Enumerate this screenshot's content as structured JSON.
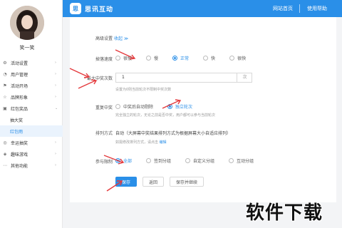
{
  "brand": {
    "logo_glyph": "思",
    "name": "思讯互动"
  },
  "topnav": {
    "home": "网站首页",
    "help": "使用帮助"
  },
  "sidebar": {
    "username": "笑一笑",
    "items": [
      {
        "label": "活动设置",
        "icon": "gear-icon",
        "glyph": "⚙"
      },
      {
        "label": "用户管理",
        "icon": "user-icon",
        "glyph": "👤"
      },
      {
        "label": "活动开场",
        "icon": "flag-icon",
        "glyph": "⚑"
      },
      {
        "label": "品牌形象",
        "icon": "star-icon",
        "glyph": "☆"
      },
      {
        "label": "红包奖品",
        "icon": "gift-icon",
        "glyph": "▣"
      },
      {
        "label": "抽大奖",
        "sub": true
      },
      {
        "label": "红包雨",
        "sub": true,
        "active": true
      },
      {
        "label": "幸运抽奖",
        "icon": "lottery-icon",
        "glyph": "◎"
      },
      {
        "label": "趣味游戏",
        "icon": "game-icon",
        "glyph": "◈"
      },
      {
        "label": "其他功能",
        "icon": "more-icon",
        "glyph": "⋯"
      }
    ]
  },
  "form": {
    "advanced": {
      "label": "高级设置",
      "toggle": "收起 ≫"
    },
    "speed": {
      "label": "掉落速度",
      "options": [
        "很慢",
        "慢",
        "正常",
        "快",
        "很快"
      ],
      "selected": "正常"
    },
    "max_wins": {
      "label": "最大中奖次数",
      "value": "1",
      "unit": "次",
      "hint": "设置为0则当前轮次不限制中奖次数"
    },
    "repeat": {
      "label": "重复中奖",
      "options": [
        "中奖后自动剔除",
        "独立轮次"
      ],
      "selected": "独立轮次",
      "hint": "完全独立的轮次，无论之前是否中奖，用户都可以参与当前轮次"
    },
    "sort": {
      "label": "排列方式",
      "text": "自动（大屏幕中奖结果排列方式为根据屏幕大小自适应排列）",
      "hint": "如需修改排列方式，请点击",
      "hint_link": "编辑"
    },
    "scope": {
      "label": "参与限制",
      "options": [
        "全部",
        "签到分组",
        "自定义分组",
        "互动分组"
      ],
      "selected": "全部"
    },
    "buttons": {
      "save": "保存",
      "back": "返回",
      "save_continue": "保存并继续"
    }
  },
  "watermark": "软件下载",
  "colors": {
    "accent": "#2a8fe8",
    "arrow": "#e4393c"
  }
}
